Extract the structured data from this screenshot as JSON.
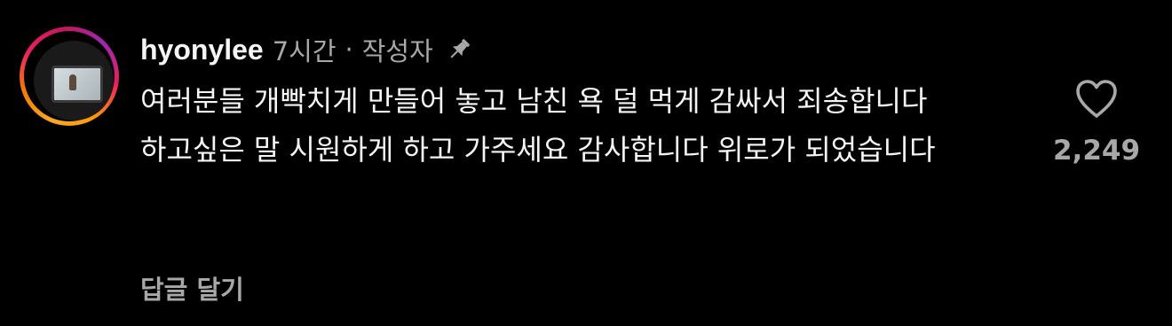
{
  "comment": {
    "username": "hyonylee",
    "time": "7시간",
    "separator": "·",
    "author_badge": "작성자",
    "pin_icon": "pin-icon",
    "paragraphs": [
      "여러분들 개빡치게 만들어 놓고 남친 욕 덜 먹게 감싸서 죄송합니다",
      "하고싶은 말 시원하게 하고 가주세요 감사합니다 위로가 되었습니다"
    ],
    "reply_label": "답글 달기",
    "like_icon": "heart-outline-icon",
    "like_count": "2,249"
  },
  "colors": {
    "background": "#000000",
    "primary_text": "#f5f5f5",
    "secondary_text": "#a8a8a8",
    "story_ring": [
      "#f9a825",
      "#e91e63",
      "#9c27b0"
    ]
  }
}
